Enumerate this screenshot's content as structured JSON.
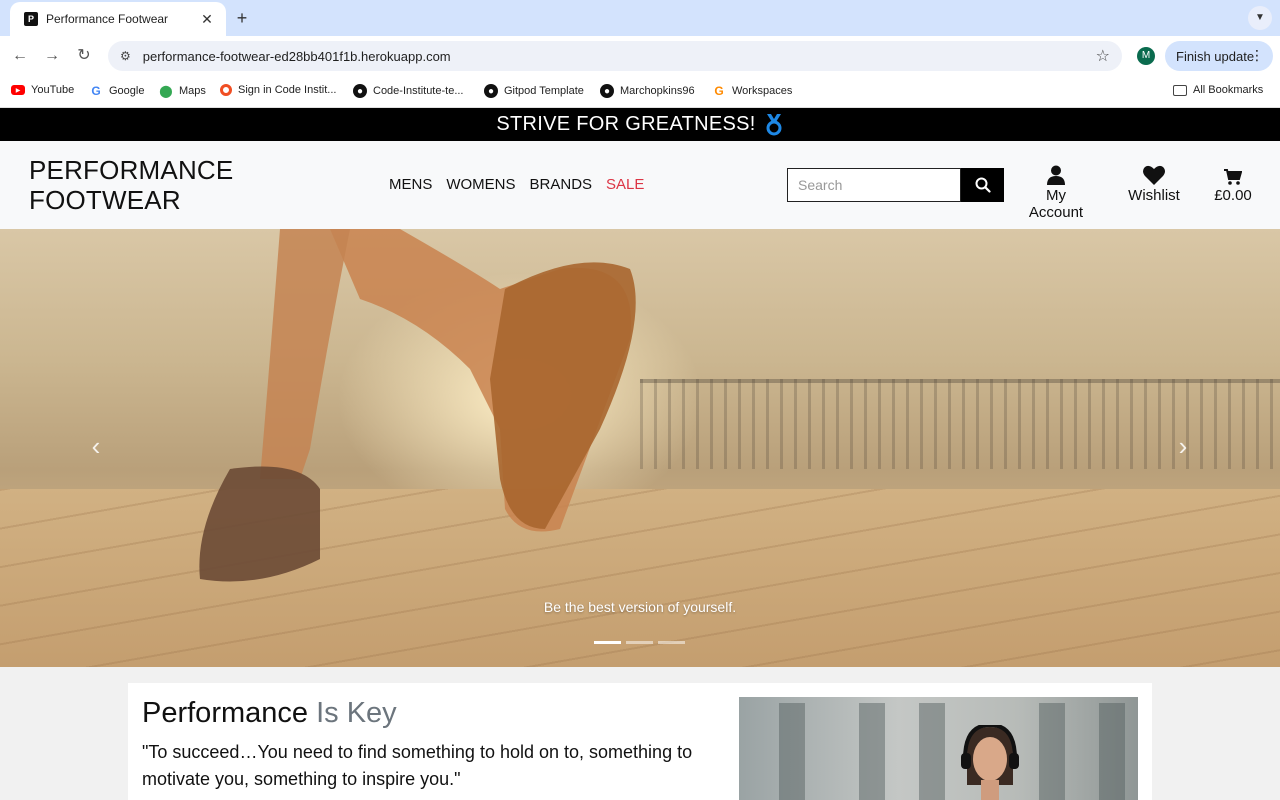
{
  "browser": {
    "tab_title": "Performance Footwear",
    "url": "performance-footwear-ed28bb401f1b.herokuapp.com",
    "profile_initial": "M",
    "finish_update_label": "Finish update",
    "bookmarks": [
      "YouTube",
      "Google",
      "Maps",
      "Sign in Code Instit...",
      "Code-Institute-te...",
      "Gitpod Template",
      "Marchopkins96",
      "Workspaces"
    ],
    "all_bookmarks_label": "All Bookmarks"
  },
  "site": {
    "banner_text": "STRIVE FOR GREATNESS!",
    "logo_line1": "PERFORMANCE",
    "logo_line2": "FOOTWEAR",
    "nav": [
      "MENS",
      "WOMENS",
      "BRANDS",
      "SALE"
    ],
    "search_placeholder": "Search",
    "account_label": "My Account",
    "wishlist_label": "Wishlist",
    "basket_total": "£0.00",
    "sale_color": "#dc3545"
  },
  "hero": {
    "caption": "Be the best version of yourself.",
    "slide_count": 3,
    "active_slide": 1
  },
  "content": {
    "heading_main": "Performance",
    "heading_muted": "Is Key",
    "quote": "\"To succeed…You need to find something to hold on to, something to motivate you, something to inspire you.\""
  }
}
